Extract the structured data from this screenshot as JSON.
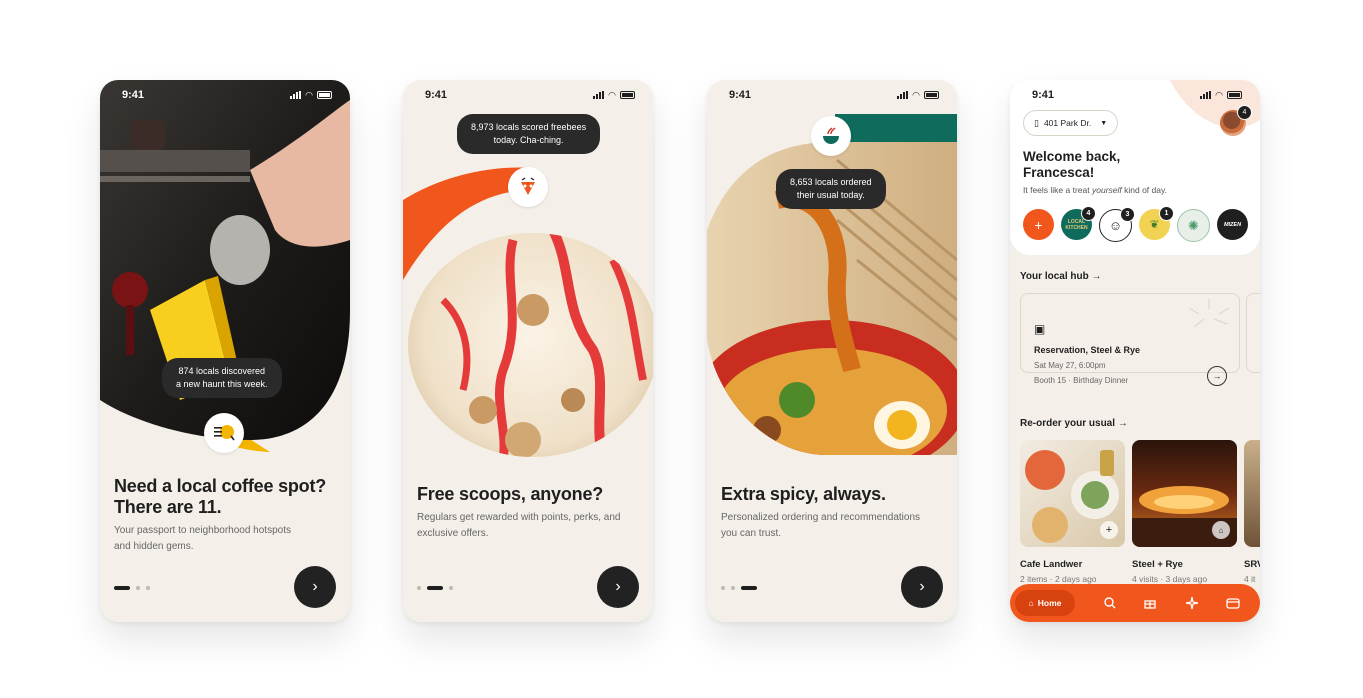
{
  "status_time": "9:41",
  "screens": [
    {
      "pill": [
        "874 locals discovered",
        "a new haunt this week."
      ],
      "headline": [
        "Need a local coffee spot?",
        "There are 11."
      ],
      "body": [
        "Your passport to neighborhood hotspots",
        "and hidden gems."
      ],
      "active_dot": 0
    },
    {
      "pill": [
        "8,973 locals scored freebees",
        "today. Cha-ching."
      ],
      "headline": [
        "Free scoops, anyone?"
      ],
      "body": [
        "Regulars get rewarded with points, perks, and",
        "exclusive offers."
      ],
      "active_dot": 1
    },
    {
      "pill": [
        "8,653 locals ordered",
        "their usual today."
      ],
      "headline": [
        "Extra spicy, always."
      ],
      "body": [
        "Personalized ordering and recommendations",
        "you can trust."
      ],
      "active_dot": 2
    }
  ],
  "home": {
    "address": "401 Park Dr.",
    "avatar_badge": "4",
    "welcome": [
      "Welcome back,",
      "Francesca!"
    ],
    "subtitle_pre": "It feels like a treat ",
    "subtitle_em": "yourself",
    "subtitle_post": " kind of day.",
    "add_label": "+",
    "restaurant_badges": [
      "4",
      "3",
      "1"
    ],
    "restaurant_marks": [
      "LOCAL KITCHEN",
      "MIZEN"
    ],
    "hub_title": "Your local hub",
    "reservation": {
      "title": "Reservation, Steel & Rye",
      "date": "Sat May 27, 6:00pm",
      "party": "Booth 15",
      "occasion": "Birthday Dinner"
    },
    "reorder_title": "Re-order your usual",
    "reorder": [
      {
        "name": "Cafe Landwer",
        "meta": "2 items · 2 days ago"
      },
      {
        "name": "Steel + Rye",
        "meta": "4 visits · 3 days ago"
      },
      {
        "name": "SRV",
        "meta": "4 it"
      }
    ],
    "nav_home": "Home",
    "arrow": "→"
  },
  "colors": {
    "accent": "#f1561d",
    "bg": "#f4f0e9",
    "dark": "#222222",
    "yellow": "#f5b400",
    "teal": "#0f6b5b"
  }
}
